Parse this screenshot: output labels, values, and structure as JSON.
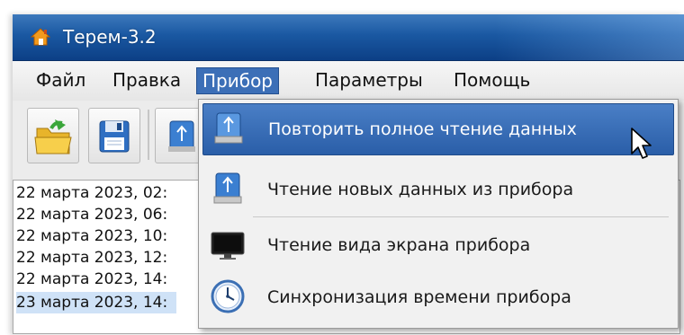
{
  "window": {
    "title": "Терем-3.2"
  },
  "menubar": {
    "items": [
      {
        "label": "Файл"
      },
      {
        "label": "Правка"
      },
      {
        "label": "Прибор",
        "active": true
      },
      {
        "label": "Параметры"
      },
      {
        "label": "Помощь"
      }
    ]
  },
  "toolbar": {
    "buttons": [
      {
        "icon": "open-folder-icon"
      },
      {
        "icon": "save-disk-icon"
      },
      {
        "icon": "usb-device-icon"
      }
    ]
  },
  "records": [
    {
      "text": "22 марта 2023, 02:"
    },
    {
      "text": "22 марта 2023, 06:"
    },
    {
      "text": "22 марта 2023, 10:"
    },
    {
      "text": "22 марта 2023, 12:"
    },
    {
      "text": "22 марта 2023, 14:"
    },
    {
      "text": "23 марта 2023, 14:",
      "selected": true
    }
  ],
  "dropdown": {
    "items": [
      {
        "label": "Повторить полное чтение данных",
        "icon": "usb-device-icon",
        "highlighted": true
      },
      {
        "label": "Чтение новых данных из прибора",
        "icon": "usb-device-icon"
      },
      {
        "label": "Чтение вида экрана прибора",
        "icon": "monitor-icon"
      },
      {
        "label": "Синхронизация времени прибора",
        "icon": "clock-icon"
      }
    ]
  },
  "colors": {
    "titlebar": "#1a58a2",
    "menu_active": "#3c6fb7",
    "menu_highlight": "#2a5ea8",
    "list_selected": "#cfe2f7"
  }
}
